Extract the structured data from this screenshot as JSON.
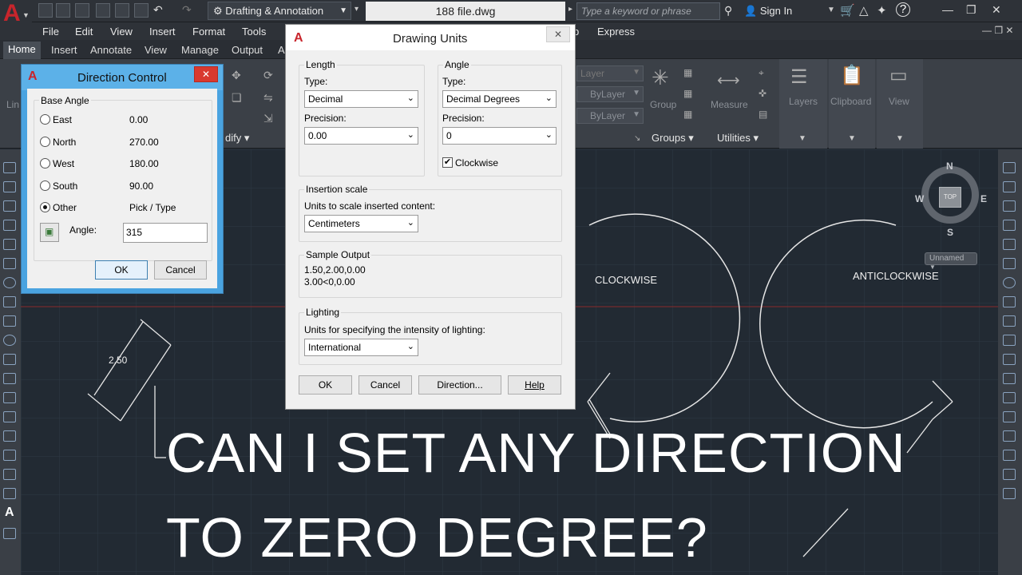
{
  "titlebar": {
    "workspace": "Drafting & Annotation",
    "file_title": "188 file.dwg",
    "search_placeholder": "Type a keyword or phrase",
    "sign_in": "Sign In"
  },
  "menubar": [
    "File",
    "Edit",
    "View",
    "Insert",
    "Format",
    "Tools",
    "p",
    "Express"
  ],
  "tabs": [
    "Home",
    "Insert",
    "Annotate",
    "View",
    "Manage",
    "Output",
    "A"
  ],
  "ribbon": {
    "left_cut_label": "Lin",
    "modify_label": "dify",
    "layer_label": "Layer",
    "bylayer1": "ByLayer",
    "bylayer2": "ByLayer",
    "group_label": "Group",
    "groups_title": "Groups",
    "measure_label": "Measure",
    "utilities_title": "Utilities",
    "layers_label": "Layers",
    "clipboard_label": "Clipboard",
    "view_label": "View"
  },
  "viewcube": {
    "n": "N",
    "s": "S",
    "e": "E",
    "w": "W",
    "top": "TOP",
    "ucs": "Unnamed"
  },
  "canvas": {
    "dimension": "2.50",
    "clockwise_label": "CLOCKWISE",
    "anticlockwise_label": "ANTICLOCKWISE",
    "headline_line1": "CAN I SET ANY DIRECTION",
    "headline_line2": "TO ZERO DEGREE?"
  },
  "direction_control": {
    "title": "Direction Control",
    "group": "Base Angle",
    "options": [
      {
        "label": "East",
        "value": "0.00"
      },
      {
        "label": "North",
        "value": "270.00"
      },
      {
        "label": "West",
        "value": "180.00"
      },
      {
        "label": "South",
        "value": "90.00"
      },
      {
        "label": "Other",
        "value": "Pick / Type"
      }
    ],
    "selected": "Other",
    "angle_label": "Angle:",
    "angle_value": "315",
    "ok": "OK",
    "cancel": "Cancel"
  },
  "drawing_units": {
    "title": "Drawing Units",
    "length": {
      "group": "Length",
      "type_label": "Type:",
      "type_value": "Decimal",
      "precision_label": "Precision:",
      "precision_value": "0.00"
    },
    "angle": {
      "group": "Angle",
      "type_label": "Type:",
      "type_value": "Decimal Degrees",
      "precision_label": "Precision:",
      "precision_value": "0",
      "clockwise_label": "Clockwise",
      "clockwise_checked": true
    },
    "insertion": {
      "group": "Insertion scale",
      "desc": "Units to scale inserted content:",
      "value": "Centimeters"
    },
    "sample": {
      "group": "Sample Output",
      "line1": "1.50,2.00,0.00",
      "line2": "3.00<0,0.00"
    },
    "lighting": {
      "group": "Lighting",
      "desc": "Units for specifying the intensity of lighting:",
      "value": "International"
    },
    "buttons": {
      "ok": "OK",
      "cancel": "Cancel",
      "direction": "Direction...",
      "help": "Help"
    }
  }
}
